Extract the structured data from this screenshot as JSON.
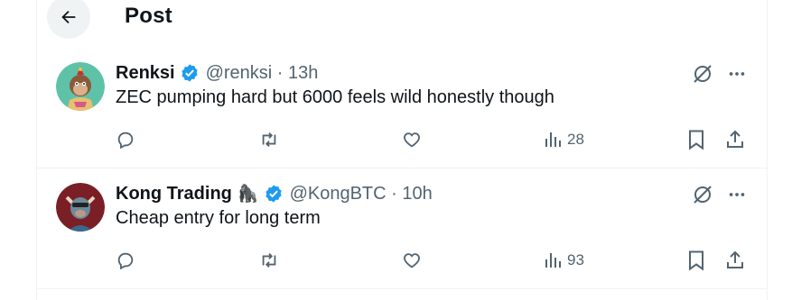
{
  "header": {
    "title": "Post"
  },
  "posts": [
    {
      "author_name": "Renksi",
      "author_emoji": "",
      "handle_time": "@renksi · 13h",
      "text": "ZEC pumping hard but 6000 feels wild honestly though",
      "views": "28",
      "avatar_color": "#5ec2a8"
    },
    {
      "author_name": "Kong Trading",
      "author_emoji": "🦍",
      "handle_time": "@KongBTC · 10h",
      "text": "Cheap entry for long term",
      "views": "93",
      "avatar_color": "#7a1f26"
    }
  ],
  "icons": {
    "back": "arrow-left-icon",
    "verified": "verified-badge-icon",
    "grok": "grok-icon",
    "more": "more-icon",
    "reply": "reply-icon",
    "repost": "repost-icon",
    "like": "like-icon",
    "views": "views-icon",
    "bookmark": "bookmark-icon",
    "share": "share-icon"
  },
  "colors": {
    "verified": "#1d9bf0",
    "text": "#0f1419",
    "muted": "#536471"
  }
}
